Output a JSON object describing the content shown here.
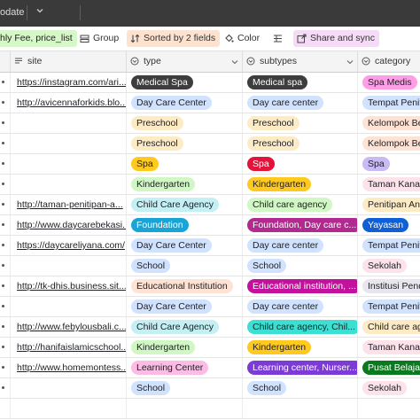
{
  "topbar": {
    "update_text": "odate"
  },
  "toolbar": {
    "fields_label": "hly Fee, price_list",
    "group_label": "Group",
    "sort_label": "Sorted by 2 fields",
    "color_label": "Color",
    "share_label": "Share and sync"
  },
  "columns": {
    "site": "site",
    "type": "type",
    "subtypes": "subtypes",
    "category": "category"
  },
  "rows": [
    {
      "site": "https://instagram.com/ari...",
      "type": {
        "text": "Medical Spa",
        "bg": "#3d3d3d",
        "fg": "#ffffff"
      },
      "subtypes": {
        "text": "Medical spa",
        "bg": "#3d3d3d",
        "fg": "#ffffff"
      },
      "category": {
        "text": "Spa Medis",
        "bg": "#ff9ee6",
        "fg": "#1d1f25"
      }
    },
    {
      "site": "http://avicennaforkids.blo...",
      "type": {
        "text": "Day Care Center",
        "bg": "#d0e2fe",
        "fg": "#1d1f25"
      },
      "subtypes": {
        "text": "Day care center",
        "bg": "#d0e2fe",
        "fg": "#1d1f25"
      },
      "category": {
        "text": "Tempat Peniti",
        "bg": "#d0e2fe",
        "fg": "#1d1f25"
      }
    },
    {
      "site": "",
      "type": {
        "text": "Preschool",
        "bg": "#fdebc6",
        "fg": "#1d1f25"
      },
      "subtypes": {
        "text": "Preschool",
        "bg": "#fdebc6",
        "fg": "#1d1f25"
      },
      "category": {
        "text": "Kelompok Ber",
        "bg": "#fee3d4",
        "fg": "#1d1f25"
      }
    },
    {
      "site": "",
      "type": {
        "text": "Preschool",
        "bg": "#fdebc6",
        "fg": "#1d1f25"
      },
      "subtypes": {
        "text": "Preschool",
        "bg": "#fdebc6",
        "fg": "#1d1f25"
      },
      "category": {
        "text": "Kelompok Ber",
        "bg": "#fee3d4",
        "fg": "#1d1f25"
      }
    },
    {
      "site": "",
      "type": {
        "text": "Spa",
        "bg": "#ffc91f",
        "fg": "#1d1f25"
      },
      "subtypes": {
        "text": "Spa",
        "bg": "#e3133c",
        "fg": "#ffffff"
      },
      "category": {
        "text": "Spa",
        "bg": "#c9b9f5",
        "fg": "#1d1f25"
      }
    },
    {
      "site": "",
      "type": {
        "text": "Kindergarten",
        "bg": "#d1f7c4",
        "fg": "#1d1f25"
      },
      "subtypes": {
        "text": "Kindergarten",
        "bg": "#ffc91f",
        "fg": "#1d1f25"
      },
      "category": {
        "text": "Taman Kanak-",
        "bg": "#fde2ea",
        "fg": "#1d1f25"
      }
    },
    {
      "site": "http://taman-penitipan-a...",
      "type": {
        "text": "Child Care Agency",
        "bg": "#c4f0f4",
        "fg": "#1d1f25"
      },
      "subtypes": {
        "text": "Child care agency",
        "bg": "#d1f7c4",
        "fg": "#1d1f25"
      },
      "category": {
        "text": "Penitipan Ana",
        "bg": "#fdebc6",
        "fg": "#1d1f25"
      }
    },
    {
      "site": "http://www.daycarebekasi...",
      "type": {
        "text": "Foundation",
        "bg": "#18a4d6",
        "fg": "#ffffff"
      },
      "subtypes": {
        "text": "Foundation, Day care c...",
        "bg": "#b22a8f",
        "fg": "#ffffff"
      },
      "category": {
        "text": "Yayasan",
        "bg": "#0f5fd6",
        "fg": "#ffffff"
      }
    },
    {
      "site": "https://daycareliyana.com/",
      "type": {
        "text": "Day Care Center",
        "bg": "#d0e2fe",
        "fg": "#1d1f25"
      },
      "subtypes": {
        "text": "Day care center",
        "bg": "#d0e2fe",
        "fg": "#1d1f25"
      },
      "category": {
        "text": "Tempat Peniti",
        "bg": "#d0e2fe",
        "fg": "#1d1f25"
      }
    },
    {
      "site": "",
      "type": {
        "text": "School",
        "bg": "#d0e2fe",
        "fg": "#1d1f25"
      },
      "subtypes": {
        "text": "School",
        "bg": "#d0e2fe",
        "fg": "#1d1f25"
      },
      "category": {
        "text": "Sekolah",
        "bg": "#fde2ea",
        "fg": "#1d1f25"
      }
    },
    {
      "site": "http://tk-dhis.business.sit...",
      "type": {
        "text": "Educational Institution",
        "bg": "#fee3d4",
        "fg": "#1d1f25"
      },
      "subtypes": {
        "text": "Educational institution, ...",
        "bg": "#c4119d",
        "fg": "#ffffff"
      },
      "category": {
        "text": "Institusi Pendi",
        "bg": "#e6e6ec",
        "fg": "#1d1f25"
      }
    },
    {
      "site": "",
      "type": {
        "text": "Day Care Center",
        "bg": "#d0e2fe",
        "fg": "#1d1f25"
      },
      "subtypes": {
        "text": "Day care center",
        "bg": "#d0e2fe",
        "fg": "#1d1f25"
      },
      "category": {
        "text": "Tempat Peniti",
        "bg": "#d0e2fe",
        "fg": "#1d1f25"
      }
    },
    {
      "site": "http://www.febylousbali.c...",
      "type": {
        "text": "Child Care Agency",
        "bg": "#c4f0f4",
        "fg": "#1d1f25"
      },
      "subtypes": {
        "text": "Child care agency, Chil...",
        "bg": "#3be0d2",
        "fg": "#1d1f25"
      },
      "category": {
        "text": "Child care age",
        "bg": "#fdebc6",
        "fg": "#1d1f25"
      }
    },
    {
      "site": "http://hanifaislamicschool....",
      "type": {
        "text": "Kindergarten",
        "bg": "#d1f7c4",
        "fg": "#1d1f25"
      },
      "subtypes": {
        "text": "Kindergarten",
        "bg": "#ffc91f",
        "fg": "#1d1f25"
      },
      "category": {
        "text": "Taman Kanak-",
        "bg": "#fde2ea",
        "fg": "#1d1f25"
      }
    },
    {
      "site": "http://www.homemontess...",
      "type": {
        "text": "Learning Center",
        "bg": "#fdbce4",
        "fg": "#1d1f25"
      },
      "subtypes": {
        "text": "Learning center, Nurser...",
        "bg": "#7c3ad6",
        "fg": "#ffffff"
      },
      "category": {
        "text": "Pusat Belajar",
        "bg": "#0a7a1f",
        "fg": "#ffffff"
      }
    },
    {
      "site": "",
      "type": {
        "text": "School",
        "bg": "#d0e2fe",
        "fg": "#1d1f25"
      },
      "subtypes": {
        "text": "School",
        "bg": "#d0e2fe",
        "fg": "#1d1f25"
      },
      "category": {
        "text": "Sekolah",
        "bg": "#fde2ea",
        "fg": "#1d1f25"
      }
    },
    {
      "site": "",
      "type": {
        "text": "",
        "bg": "",
        "fg": ""
      },
      "subtypes": {
        "text": "",
        "bg": "",
        "fg": ""
      },
      "category": {
        "text": "",
        "bg": "",
        "fg": ""
      }
    }
  ]
}
